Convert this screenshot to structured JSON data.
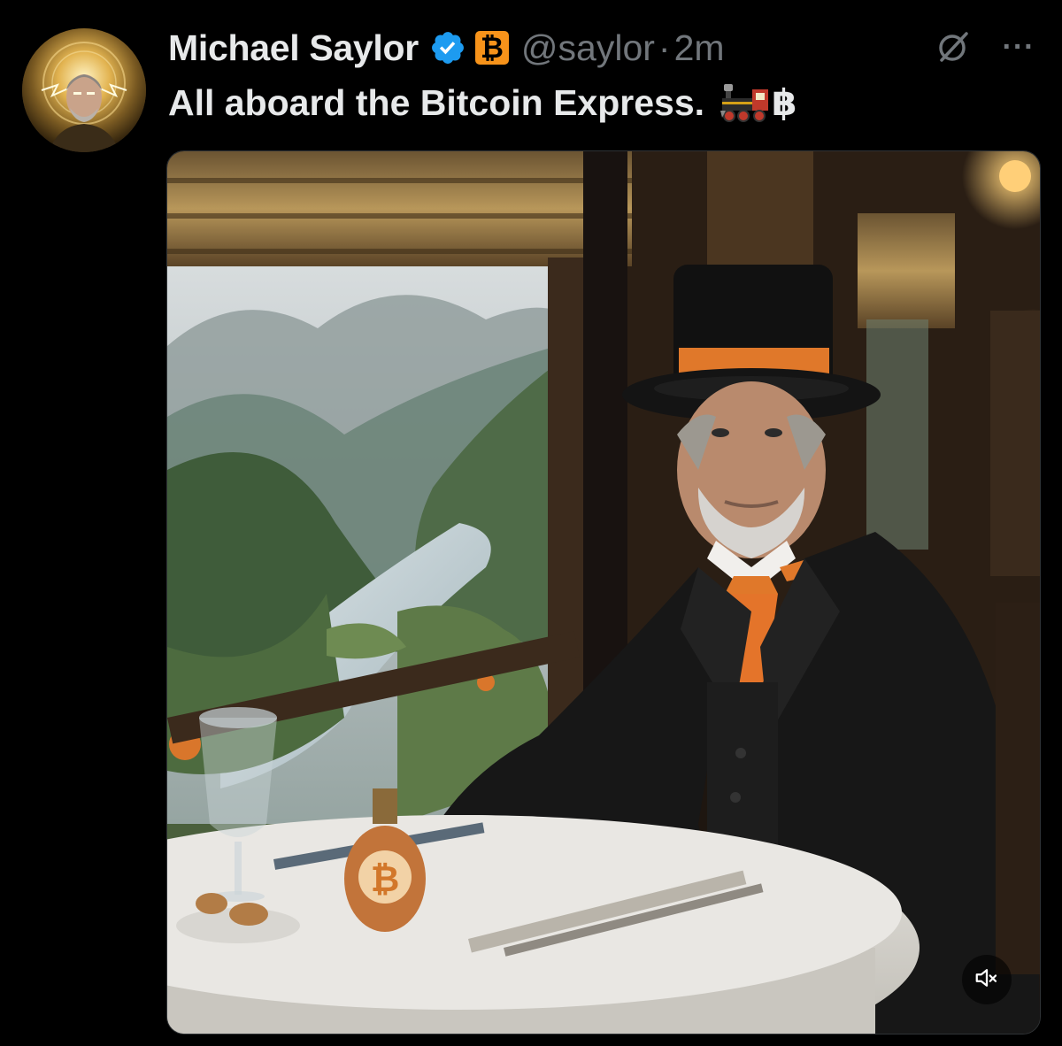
{
  "author": {
    "display_name": "Michael Saylor",
    "verified_icon": "verified-badge-icon",
    "badge_icon": "bitcoin-badge-icon",
    "badge_glyph": "₿",
    "handle": "@saylor",
    "separator": "·",
    "time": "2m"
  },
  "actions": {
    "grok_icon": "grok-icon",
    "more_label": "···"
  },
  "tweet": {
    "text": "All aboard the Bitcoin Express.",
    "emoji_train": "locomotive-emoji-icon",
    "emoji_btc": "฿"
  },
  "media": {
    "type": "video",
    "mute_icon": "muted-speaker-icon"
  },
  "colors": {
    "background": "#000000",
    "primary_text": "#e7e9ea",
    "secondary_text": "#71767b",
    "verified_blue": "#1d9bf0",
    "bitcoin_orange": "#f7931a"
  }
}
